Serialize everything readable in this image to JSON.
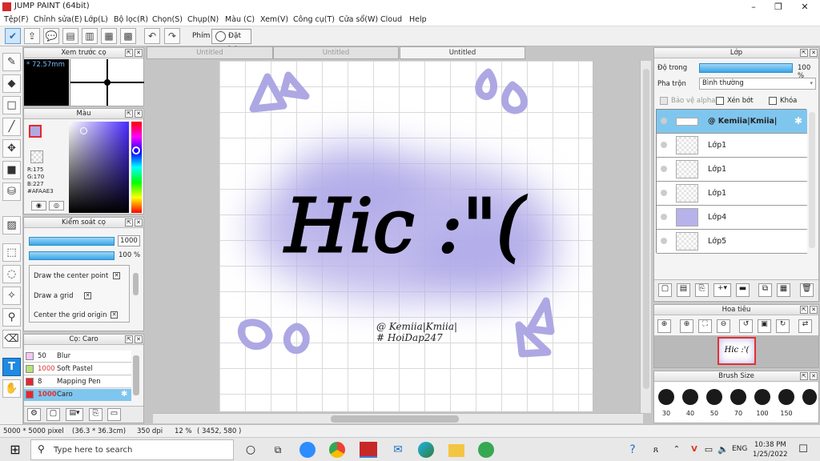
{
  "app": {
    "title": "JUMP PAINT (64bit)"
  },
  "window_controls": {
    "minimize": "–",
    "restore": "❐",
    "close": "✕"
  },
  "menu": [
    "Tệp(F)",
    "Chỉnh sửa(E)",
    "Lớp(L)",
    "Bộ lọc(R)",
    "Chọn(S)",
    "Chụp(N)",
    "Màu (C)",
    "Xem(V)",
    "Công cụ(T)",
    "Cửa sổ(W)",
    "Cloud",
    "Help"
  ],
  "toolbar": {
    "phim_label": "Phím",
    "reset_label": "Đặt lại"
  },
  "tabs": [
    "Untitled",
    "Untitled",
    "Untitled"
  ],
  "brush_preview": {
    "title": "Xem trước cọ",
    "size": "* 72.57mm"
  },
  "color": {
    "title": "Màu",
    "r": "R:175",
    "g": "G:170",
    "b": "B:227",
    "hex": "#AFAAE3",
    "current": "#AFAAE3"
  },
  "brush_control": {
    "title": "Kiểm soát cọ",
    "size_value": "1000",
    "opacity_value": "100",
    "opacity_unit": "%",
    "options": [
      "Draw the center point",
      "Draw a grid",
      "Center the grid origin"
    ]
  },
  "brush_list": {
    "title": "Cọ: Caro",
    "items": [
      {
        "size": "50",
        "name": "Blur",
        "color": "#f2c7f2"
      },
      {
        "size": "1000",
        "name": "Soft Pastel",
        "color": "#b8e07a"
      },
      {
        "size": "8",
        "name": "Mapping Pen",
        "color": "#e8262f"
      },
      {
        "size": "1000",
        "name": "Caro",
        "color": "#e8262f"
      }
    ]
  },
  "canvas_art": {
    "main_text": "Hic :\"(",
    "credit1": "@ Kemiia|Kmiia|",
    "credit2": "# HoiDap247"
  },
  "layers": {
    "title": "Lớp",
    "opacity_label": "Độ trong",
    "opacity_value": "100 %",
    "blend_label": "Pha trộn",
    "blend_value": "Bình thường",
    "protect_alpha": "Bảo vệ alpha",
    "clip": "Xén bớt",
    "lock": "Khóa",
    "rows": [
      {
        "name": "@ Kemiia|Kmiia|",
        "selected": true
      },
      {
        "name": "Lớp1",
        "selected": false
      },
      {
        "name": "Lớp1",
        "selected": false
      },
      {
        "name": "Lớp1",
        "selected": false
      },
      {
        "name": "Lớp4",
        "selected": false
      },
      {
        "name": "Lớp5",
        "selected": false
      }
    ]
  },
  "navigator": {
    "title": "Hoa tiêu",
    "thumb_text": "Hic :'("
  },
  "brush_size": {
    "title": "Brush Size",
    "sizes": [
      "30",
      "40",
      "50",
      "70",
      "100",
      "150"
    ]
  },
  "status": {
    "dims": "5000 * 5000 pixel",
    "physical": "(36.3 * 36.3cm)",
    "dpi": "350 dpi",
    "zoom": "12 %",
    "coords": "( 3452, 580 )"
  },
  "taskbar": {
    "search_placeholder": "Type here to search",
    "lang": "ENG",
    "time": "10:38 PM",
    "date": "1/25/2022"
  }
}
